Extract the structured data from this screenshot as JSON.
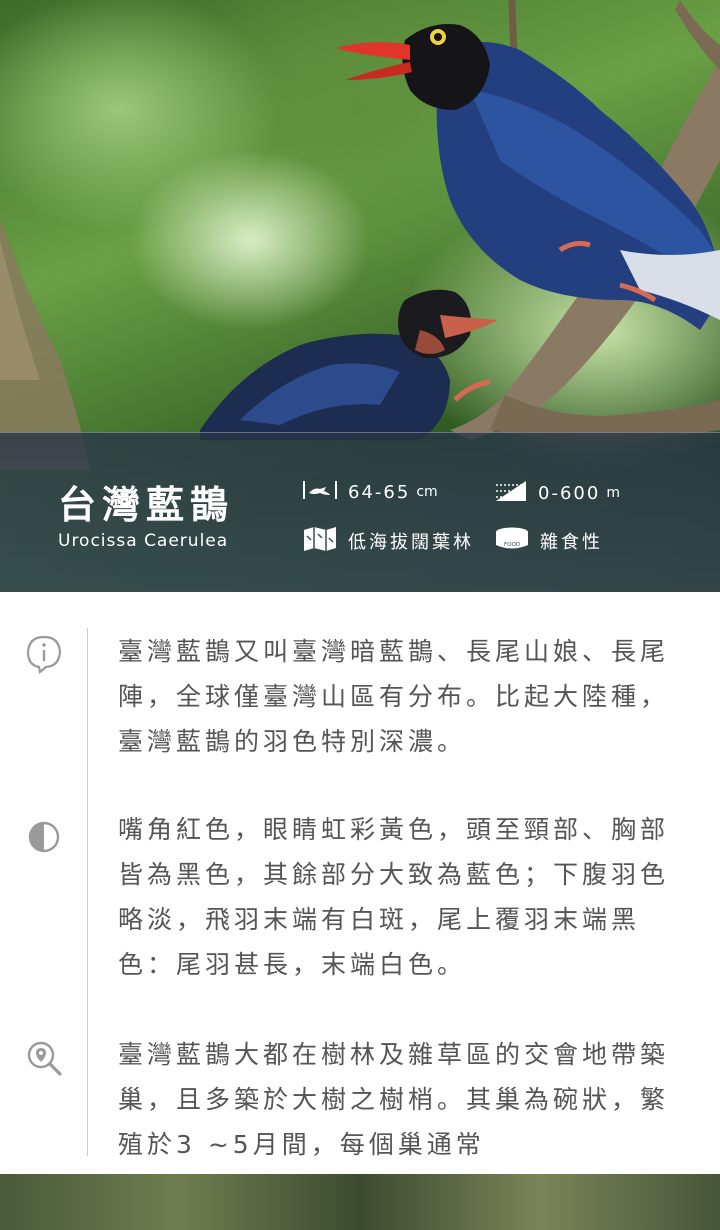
{
  "species": {
    "name_zh": "台灣藍鵲",
    "name_latin": "Urocissa Caerulea"
  },
  "stats": {
    "length": {
      "icon": "bird-length-icon",
      "value": "64-65",
      "unit": "cm"
    },
    "altitude": {
      "icon": "altitude-icon",
      "value": "0-600",
      "unit": "m"
    },
    "habitat": {
      "icon": "map-icon",
      "text": "低海拔闊葉林"
    },
    "diet": {
      "icon": "food-icon",
      "icon_label": "FOOD",
      "text": "雜食性"
    }
  },
  "sections": [
    {
      "icon": "info-icon",
      "text": "臺灣藍鵲又叫臺灣暗藍鵲、長尾山娘、長尾陣，全球僅臺灣山區有分布。比起大陸種，臺灣藍鵲的羽色特別深濃。"
    },
    {
      "icon": "appearance-icon",
      "text": "嘴角紅色，眼睛虹彩黃色，頭至頸部、胸部皆為黑色，其餘部分大致為藍色；下腹羽色略淡，飛羽末端有白斑，尾上覆羽末端黑色：尾羽甚長，末端白色。"
    },
    {
      "icon": "location-search-icon",
      "text": "臺灣藍鵲大都在樹林及雜草區的交會地帶築巢，且多築於大樹之樹梢。其巢為碗狀，繁殖於3 ~5月間，每個巢通常"
    }
  ],
  "colors": {
    "band": "#2c3a4e",
    "body_text": "#555555",
    "icon": "#9a9a9a",
    "bird_blue": "#2a4a8a",
    "beak_red": "#e0352b"
  }
}
